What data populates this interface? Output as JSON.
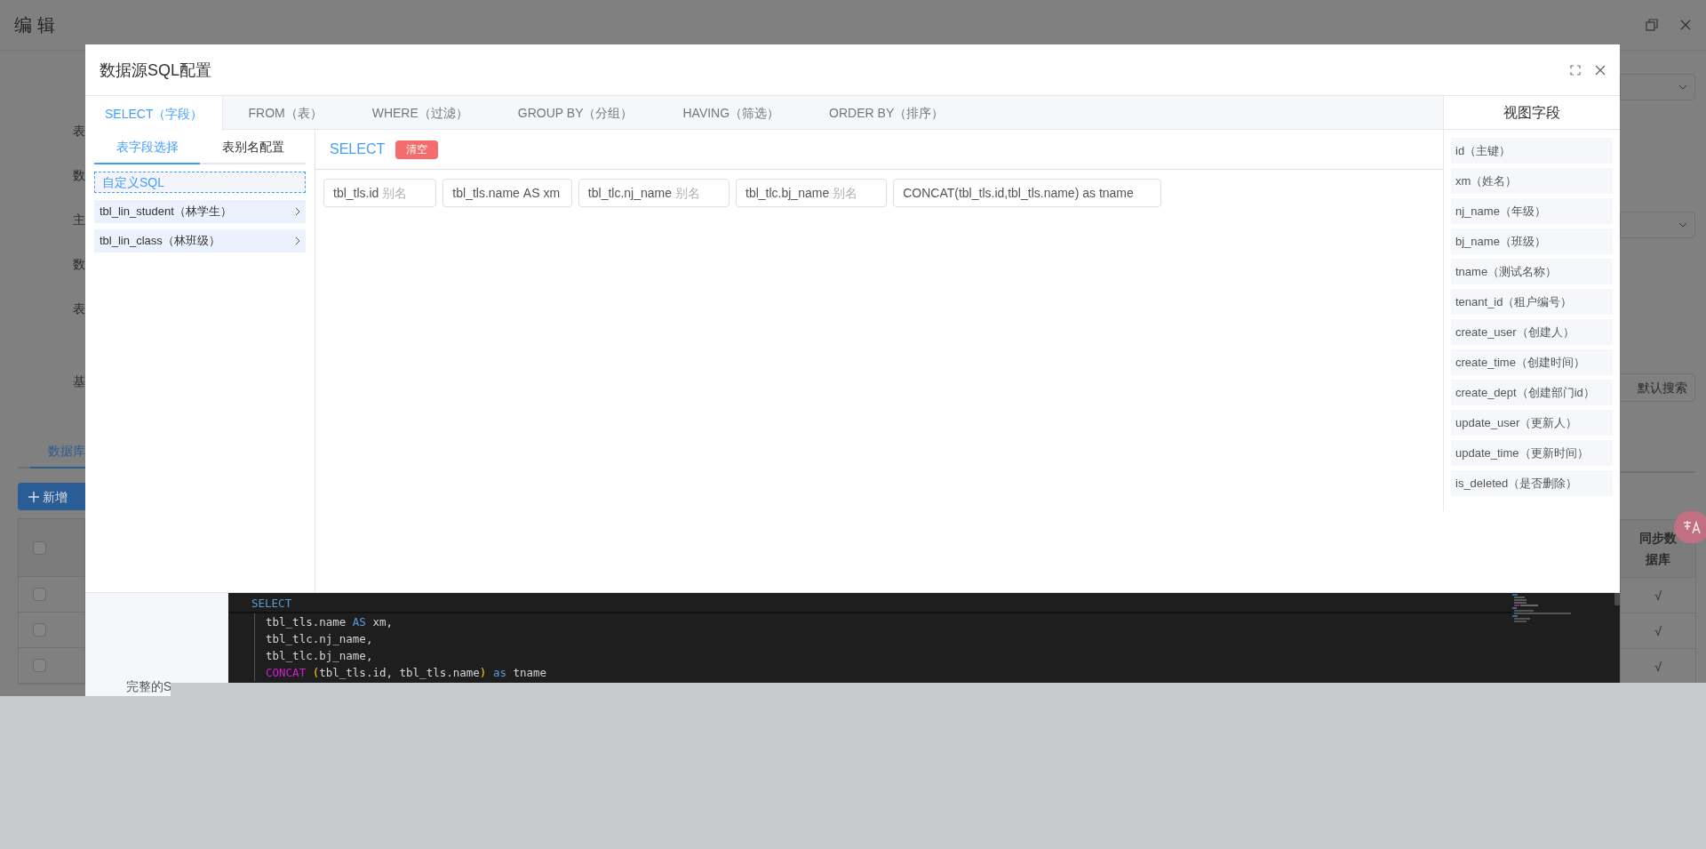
{
  "background_page": {
    "title": "编 辑",
    "form_labels": [
      "表",
      "数",
      "主",
      "数",
      "表",
      "基"
    ],
    "tab": "数据库",
    "add_button": "新增",
    "search_button": "默认搜索",
    "table_header": "同步数据库",
    "header_checkbox": {
      "checked": false
    },
    "table_rows": [
      {
        "checked": false,
        "sync": "√"
      },
      {
        "checked": false,
        "sync": "√"
      },
      {
        "checked": false,
        "sync": "√"
      }
    ]
  },
  "dialog": {
    "title": "数据源SQL配置",
    "tabs": [
      {
        "label": "SELECT（字段）",
        "selected": true
      },
      {
        "label": "FROM（表）",
        "selected": false
      },
      {
        "label": "WHERE（过滤）",
        "selected": false
      },
      {
        "label": "GROUP BY（分组）",
        "selected": false
      },
      {
        "label": "HAVING（筛选）",
        "selected": false
      },
      {
        "label": "ORDER BY（排序）",
        "selected": false
      }
    ],
    "left_tabs": [
      {
        "label": "表字段选择",
        "selected": true
      },
      {
        "label": "表别名配置",
        "selected": false
      }
    ],
    "custom_sql": "自定义SQL",
    "tables": [
      {
        "label": "tbl_lin_student（林学生）"
      },
      {
        "label": "tbl_lin_class（林班级）"
      }
    ],
    "select_label": "SELECT",
    "clear_button": "清空",
    "fields": [
      {
        "expression": "tbl_tls.id",
        "placeholder": "别名"
      },
      {
        "expression": "tbl_tls.name",
        "value": "AS xm"
      },
      {
        "expression": "tbl_tlc.nj_name",
        "placeholder": "别名"
      },
      {
        "expression": "tbl_tlc.bj_name",
        "placeholder": "别名"
      },
      {
        "expression": "CONCAT(tbl_tls.id,tbl_tls.name) as tname"
      }
    ],
    "view_fields_title": "视图字段",
    "view_fields": [
      "id（主键）",
      "xm（姓名）",
      "nj_name（年级）",
      "bj_name（班级）",
      "tname（测试名称）",
      "tenant_id（租户编号）",
      "create_user（创建人）",
      "create_time（创建时间）",
      "create_dept（创建部门id）",
      "update_user（更新人）",
      "update_time（更新时间）",
      "is_deleted（是否删除）"
    ],
    "full_sql_label": "完整的S",
    "code_lines": [
      [
        {
          "kind": "keyword",
          "text": "SELECT"
        }
      ],
      [
        {
          "kind": "plain",
          "text": "tbl_tls.name "
        },
        {
          "kind": "keyword",
          "text": "AS"
        },
        {
          "kind": "plain",
          "text": " xm,"
        }
      ],
      [
        {
          "kind": "plain",
          "text": "tbl_tlc.nj_name,"
        }
      ],
      [
        {
          "kind": "plain",
          "text": "tbl_tlc.bj_name,"
        }
      ],
      [
        {
          "kind": "function",
          "text": "CONCAT"
        },
        {
          "kind": "bracket",
          "text": " ("
        },
        {
          "kind": "plain",
          "text": "tbl_tls.id, tbl_tls.name"
        },
        {
          "kind": "bracket",
          "text": ") "
        },
        {
          "kind": "keyword",
          "text": "as"
        },
        {
          "kind": "plain",
          "text": " tname"
        }
      ]
    ]
  }
}
